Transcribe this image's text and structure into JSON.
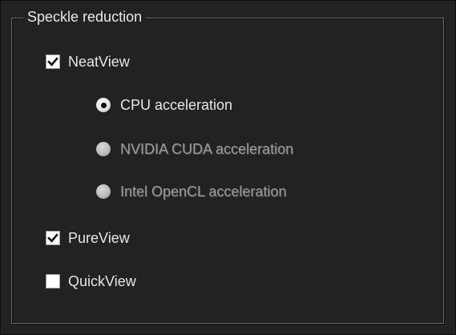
{
  "group": {
    "title": "Speckle reduction"
  },
  "options": {
    "neatview": {
      "label": "NeatView",
      "checked": true
    },
    "cpu": {
      "label": "CPU acceleration",
      "selected": true,
      "enabled": true
    },
    "cuda": {
      "label": "NVIDIA CUDA acceleration",
      "selected": false,
      "enabled": false
    },
    "opencl": {
      "label": "Intel OpenCL acceleration",
      "selected": false,
      "enabled": false
    },
    "pureview": {
      "label": "PureView",
      "checked": true
    },
    "quickview": {
      "label": "QuickView",
      "checked": false
    }
  },
  "colors": {
    "background": "#222222",
    "text": "#e6e6e6",
    "disabled_text": "#9a9a9a",
    "frame_line": "#6a6a6a"
  }
}
